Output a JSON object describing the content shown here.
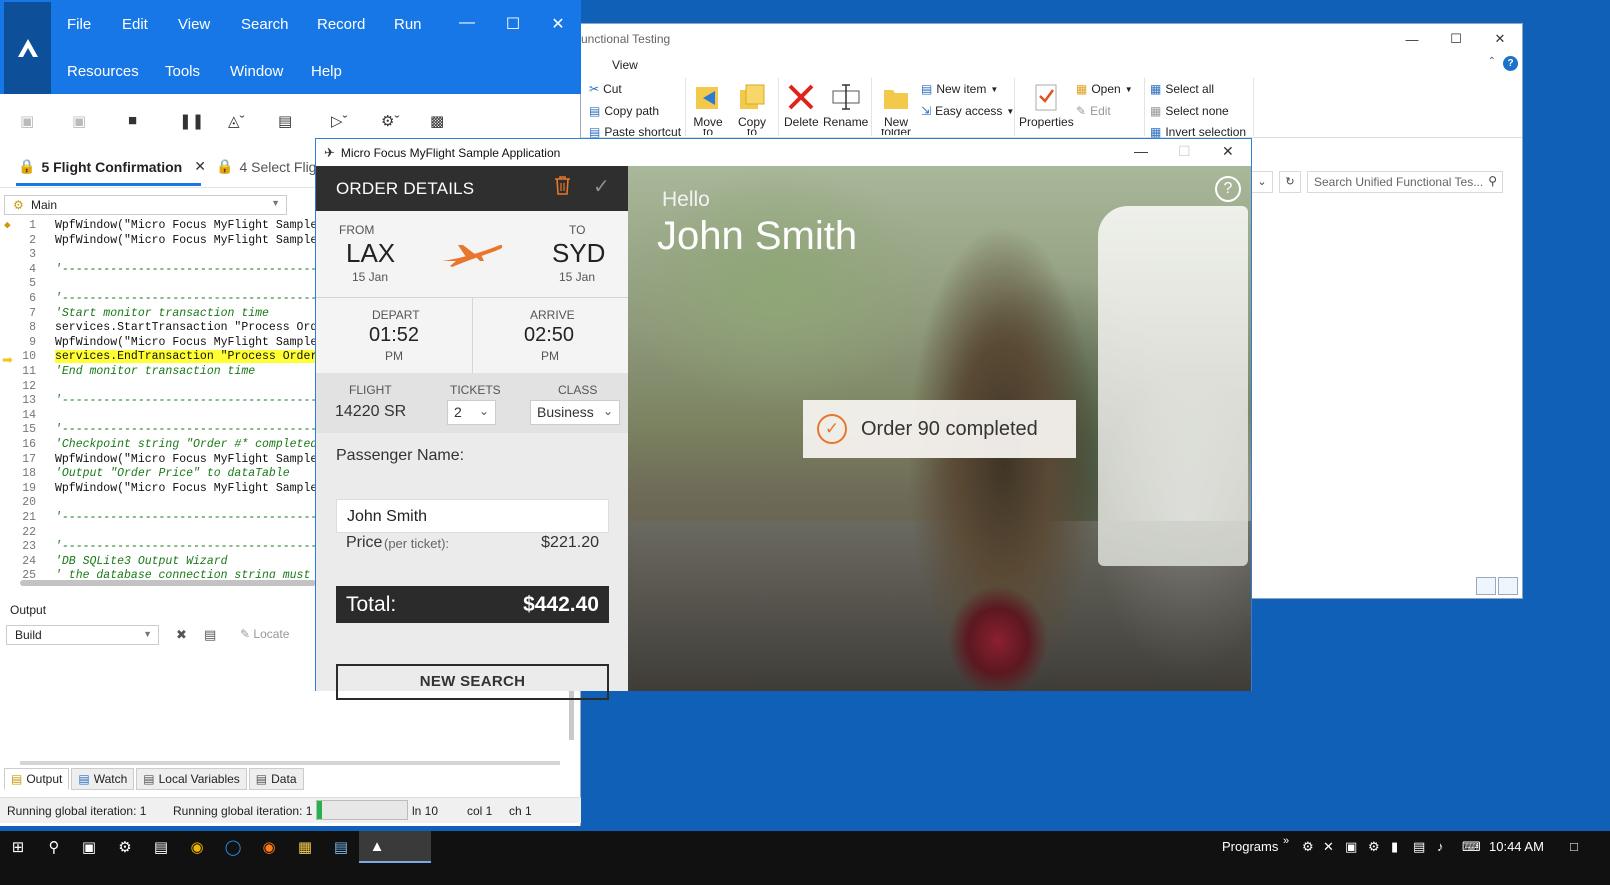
{
  "explorer": {
    "title": "unctional Testing",
    "menu_view": "View",
    "ribbon": {
      "cut": "Cut",
      "copy_path": "Copy path",
      "paste_shortcut": "Paste shortcut",
      "move_to": "Move",
      "move_to_2": "to",
      "copy_to": "Copy",
      "copy_to_2": "to",
      "delete": "Delete",
      "rename": "Rename",
      "new_folder": "New",
      "new_folder_2": "folder",
      "new_item": "New item",
      "easy_access": "Easy access",
      "properties": "Properties",
      "open": "Open",
      "edit": "Edit",
      "select_all": "Select all",
      "select_none": "Select none",
      "invert_selection": "Invert selection"
    },
    "search_placeholder": "Search Unified Functional Tes..."
  },
  "uft": {
    "menu": [
      "File",
      "Edit",
      "View",
      "Search",
      "Record",
      "Run",
      "Resources",
      "Tools",
      "Window",
      "Help"
    ],
    "tabs": [
      {
        "label": "5 Flight Confirmation",
        "active": true
      },
      {
        "label": "4 Select Flig",
        "active": false
      }
    ],
    "selector": "Main",
    "code": [
      {
        "n": "1",
        "t": "WpfWindow(\"Micro Focus MyFlight Sample",
        "type": "code"
      },
      {
        "n": "2",
        "t": "WpfWindow(\"Micro Focus MyFlight Sample",
        "type": "code"
      },
      {
        "n": "3",
        "t": "",
        "type": "code"
      },
      {
        "n": "4",
        "t": "'-------------------------------------------",
        "type": "cmt"
      },
      {
        "n": "5",
        "t": "",
        "type": "code"
      },
      {
        "n": "6",
        "t": "'-------------------------------------------",
        "type": "cmt"
      },
      {
        "n": "7",
        "t": "'Start monitor transaction time",
        "type": "cmt"
      },
      {
        "n": "8",
        "t": "services.StartTransaction \"Process Ord",
        "type": "code"
      },
      {
        "n": "9",
        "t": "WpfWindow(\"Micro Focus MyFlight Sample",
        "type": "code"
      },
      {
        "n": "10",
        "t": "services.EndTransaction \"Process Order",
        "type": "hl"
      },
      {
        "n": "11",
        "t": "'End monitor transaction time",
        "type": "cmt"
      },
      {
        "n": "12",
        "t": "",
        "type": "code"
      },
      {
        "n": "13",
        "t": "'-------------------------------------------",
        "type": "cmt"
      },
      {
        "n": "14",
        "t": "",
        "type": "code"
      },
      {
        "n": "15",
        "t": "'-------------------------------------------",
        "type": "cmt"
      },
      {
        "n": "16",
        "t": "'Checkpoint string \"Order #* completed",
        "type": "cmt"
      },
      {
        "n": "17",
        "t": "WpfWindow(\"Micro Focus MyFlight Sample",
        "type": "code"
      },
      {
        "n": "18",
        "t": "'Output \"Order Price\" to dataTable",
        "type": "cmt"
      },
      {
        "n": "19",
        "t": "WpfWindow(\"Micro Focus MyFlight Sample",
        "type": "code"
      },
      {
        "n": "20",
        "t": "",
        "type": "code"
      },
      {
        "n": "21",
        "t": "'-------------------------------------------",
        "type": "cmt"
      },
      {
        "n": "22",
        "t": "",
        "type": "code"
      },
      {
        "n": "23",
        "t": "'-------------------------------------------",
        "type": "cmt"
      },
      {
        "n": "24",
        "t": "'DB SQLite3 Output Wizard",
        "type": "cmt"
      },
      {
        "n": "25",
        "t": "' the database connection string must",
        "type": "cmt"
      }
    ],
    "output_label": "Output",
    "output_dropdown": "Build",
    "locate": "Locate",
    "bottom_tabs": [
      "Output",
      "Watch",
      "Local Variables",
      "Data"
    ],
    "status": {
      "left": "Running global iteration: 1",
      "mid": "Running global iteration: 1",
      "progress": 0.05,
      "ln": "ln 10",
      "col": "col 1",
      "ch": "ch 1"
    }
  },
  "myflight": {
    "title": "Micro Focus MyFlight Sample Application",
    "order_details": "ORDER DETAILS",
    "from_label": "FROM",
    "from_code": "LAX",
    "from_date": "15 Jan",
    "to_label": "TO",
    "to_code": "SYD",
    "to_date": "15 Jan",
    "depart_label": "DEPART",
    "depart_time": "01:52",
    "depart_ampm": "PM",
    "arrive_label": "ARRIVE",
    "arrive_time": "02:50",
    "arrive_ampm": "PM",
    "flight_label": "FLIGHT",
    "flight_no": "14220 SR",
    "tickets_label": "TICKETS",
    "tickets": "2",
    "class_label": "CLASS",
    "class": "Business",
    "passenger_label": "Passenger Name:",
    "passenger_name": "John Smith",
    "price_label": "Price",
    "price_sub": "(per ticket):",
    "price": "$221.20",
    "total_label": "Total:",
    "total": "$442.40",
    "new_search": "NEW SEARCH",
    "hello": "Hello",
    "user": "John Smith",
    "toast": "Order 90 completed"
  },
  "taskbar": {
    "programs": "Programs",
    "time": "10:44 AM"
  }
}
